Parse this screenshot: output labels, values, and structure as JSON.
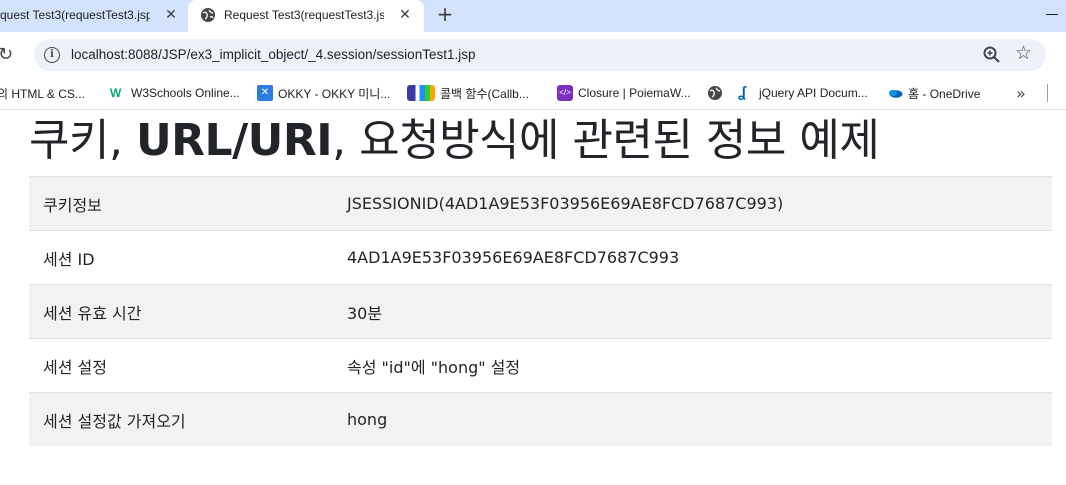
{
  "browser": {
    "tabs": [
      {
        "title": "quest Test3(requestTest3.jsp",
        "active": false
      },
      {
        "title": "Request Test3(requestTest3.jsp",
        "active": true
      }
    ],
    "new_tab_label": "+",
    "url": "localhost:8088/JSP/ex3_implicit_object/_4.session/sessionTest1.jsp"
  },
  "bookmarks": [
    {
      "label": "의 HTML & CS...",
      "icon": "none"
    },
    {
      "label": "W3Schools Online...",
      "icon": "w3schools-icon"
    },
    {
      "label": "OKKY - OKKY 미니...",
      "icon": "okky-icon"
    },
    {
      "label": "콜백 함수(Callb...",
      "icon": "callback-icon"
    },
    {
      "label": "Closure | PoiemaW...",
      "icon": "code-icon"
    },
    {
      "label": "",
      "icon": "globe-icon"
    },
    {
      "label": "jQuery API Docum...",
      "icon": "jquery-icon"
    },
    {
      "label": "홈 - OneDrive",
      "icon": "onedrive-icon"
    }
  ],
  "page": {
    "title_part1": "쿠키, ",
    "title_bold": "URL/URI",
    "title_part2": ", 요청방식에 관련된 정보 예제",
    "rows": [
      {
        "label": "쿠키정보",
        "value": "JSESSIONID(4AD1A9E53F03956E69AE8FCD7687C993)"
      },
      {
        "label": "세션 ID",
        "value": "4AD1A9E53F03956E69AE8FCD7687C993"
      },
      {
        "label": "세션 유효 시간",
        "value": "30분"
      },
      {
        "label": "세션 설정",
        "value": "속성 \"id\"에 \"hong\" 설정"
      },
      {
        "label": "세션 설정값 가져오기",
        "value": "hong"
      }
    ]
  },
  "colors": {
    "tab_strip": "#d3e3fd",
    "omnibox": "#edf2fa",
    "row_stripe": "#f2f2f2",
    "text": "#212529"
  }
}
